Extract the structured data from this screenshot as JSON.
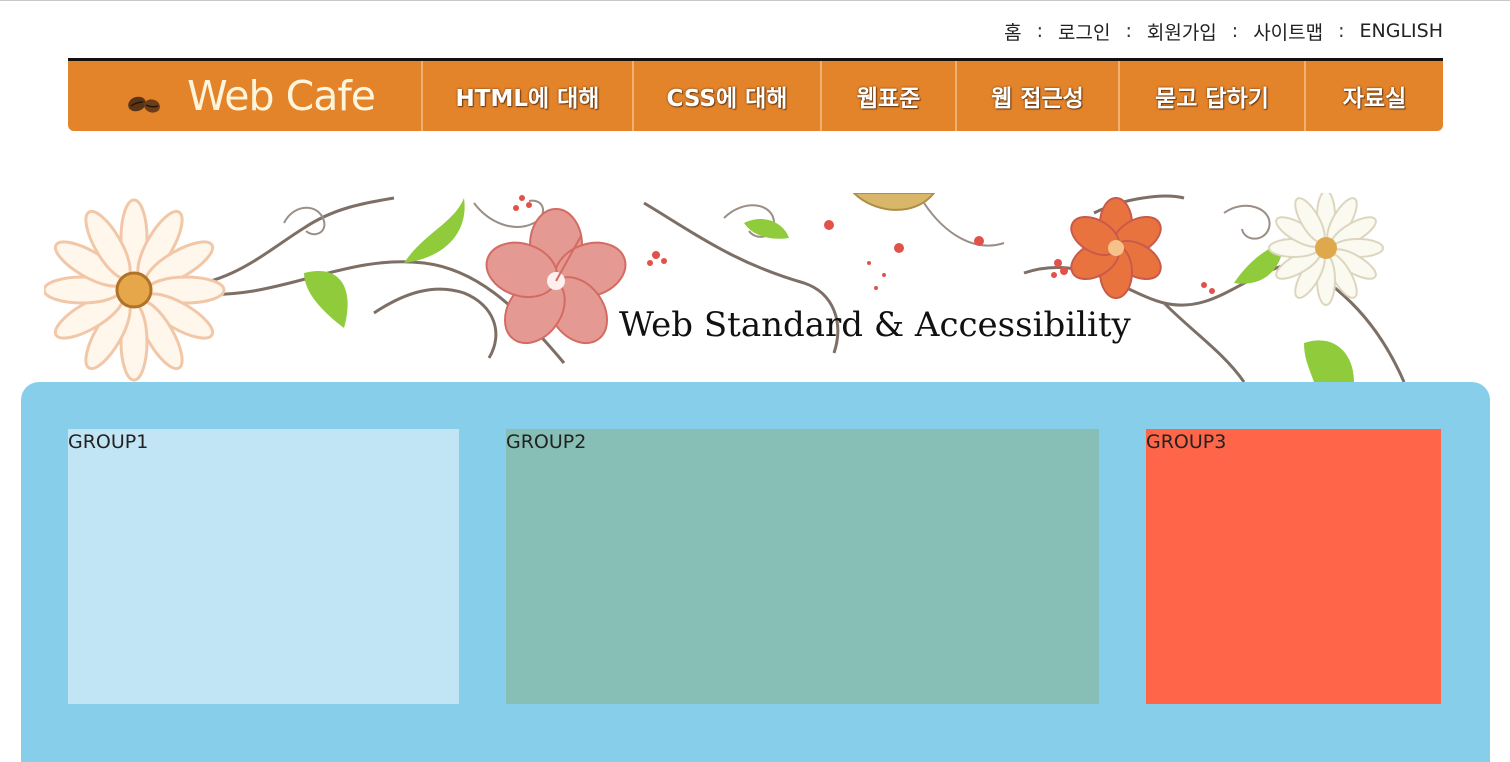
{
  "util_links": [
    "홈",
    "로그인",
    "회원가입",
    "사이트맵",
    "ENGLISH"
  ],
  "util_separator": ":",
  "logo": {
    "text": "Web Cafe"
  },
  "menu": [
    "HTML에 대해",
    "CSS에 대해",
    "웹표준",
    "웹 접근성",
    "묻고 답하기",
    "자료실"
  ],
  "banner": {
    "title": "Web Standard & Accessibility"
  },
  "groups": [
    "GROUP1",
    "GROUP2",
    "GROUP3"
  ],
  "colors": {
    "header": "#e3832a",
    "container": "#87ceeb",
    "group1": "#c2e5f5",
    "group2": "#87bfb6",
    "group3": "#ff6548"
  }
}
